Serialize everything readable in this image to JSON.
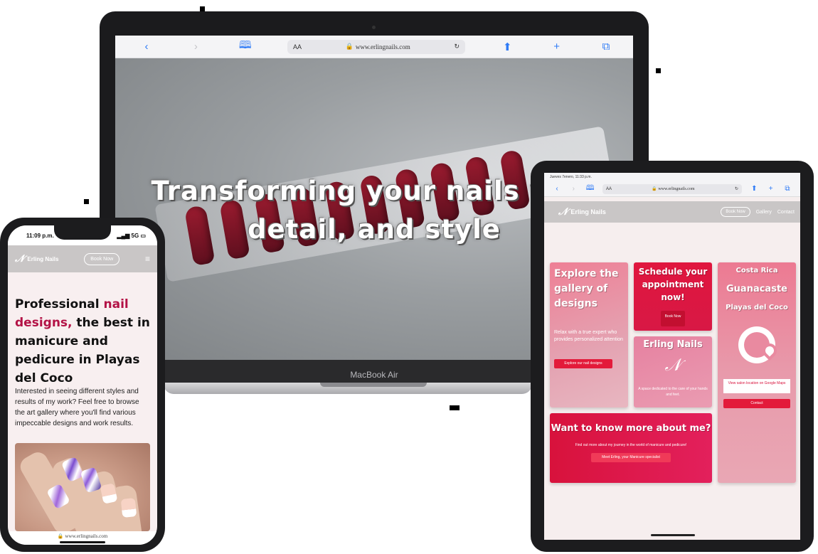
{
  "laptop": {
    "url": "www.erlingnails.com",
    "aa_label": "AA",
    "hero_title_line1": "Transforming your nails with",
    "hero_title_line2": "detail, and style",
    "model_label": "MacBook Air"
  },
  "phone": {
    "time": "11:09 p.m.",
    "network": "5G",
    "brand": "Erling Nails",
    "book_button": "Book Now",
    "heading_pre": "Professional ",
    "heading_accent": "nail designs,",
    "heading_post": " the best in manicure and pedicure in Playas del Coco",
    "paragraph": "Interested in seeing different styles and results of my work? Feel free to browse the art gallery where you'll find various impeccable designs and work results.",
    "url": "www.erlingnails.com"
  },
  "tablet": {
    "status_text": "Jueves 7enero, 11:33 p.m.",
    "aa_label": "AA",
    "url": "www.erlingnails.com",
    "brand": "Erling Nails",
    "nav": {
      "book": "Book Now",
      "gallery": "Gallery",
      "contact": "Contact"
    },
    "card_gallery": {
      "title": "Explore the gallery of designs",
      "text": "Relax with a true expert who provides personalized attention",
      "button": "Explore our nail designs"
    },
    "card_schedule": {
      "title": "Schedule your appointment now!",
      "button": "Book Now"
    },
    "card_brand": {
      "title": "Erling Nails",
      "text": "A space dedicated to the care of your hands and feet."
    },
    "card_location": {
      "line1": "Costa Rica",
      "line2": "Guanacaste",
      "line3": "Playas del Coco",
      "map_button": "View salon location on Google Maps",
      "contact_button": "Contact"
    },
    "card_about": {
      "title": "Want to know more about me?",
      "text": "Find out more about my journey in the world of manicure and pedicure!",
      "button": "Meet Erling, your Manicure specialist"
    }
  }
}
